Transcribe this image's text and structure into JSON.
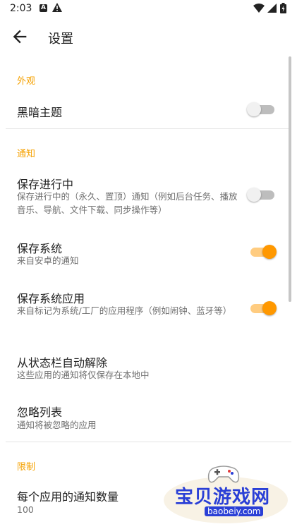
{
  "status_bar": {
    "time": "2:03",
    "notification_icon_letter": "A"
  },
  "app_bar": {
    "title": "设置"
  },
  "sections": {
    "appearance": {
      "header": "外观",
      "dark_theme": {
        "title": "黑暗主题",
        "enabled": false
      }
    },
    "notifications": {
      "header": "通知",
      "ongoing": {
        "title": "保存进行中",
        "summary": "保存进行中的（永久、置顶）通知（例如后台任务、播放音乐、导航、文件下载、同步操作等）",
        "enabled": false
      },
      "system": {
        "title": "保存系统",
        "summary": "来自安卓的通知",
        "enabled": true
      },
      "system_apps": {
        "title": "保存系统应用",
        "summary": "来自标记为系统/工厂的应用程序（例如闹钟、蓝牙等）",
        "enabled": true
      },
      "auto_dismiss": {
        "title": "从状态栏自动解除",
        "summary": "这些应用的通知将仅保存在本地中"
      },
      "ignore_list": {
        "title": "忽略列表",
        "summary": "通知将被忽略的应用"
      }
    },
    "limits": {
      "header": "限制",
      "per_app": {
        "title": "每个应用的通知数量",
        "summary": "100"
      }
    }
  },
  "watermark": {
    "text": "宝贝游戏网",
    "url": "baobeiy.com"
  },
  "colors": {
    "accent": "#ff9800",
    "section_header": "#f5a100",
    "watermark_blue": "#2a3fd6"
  }
}
